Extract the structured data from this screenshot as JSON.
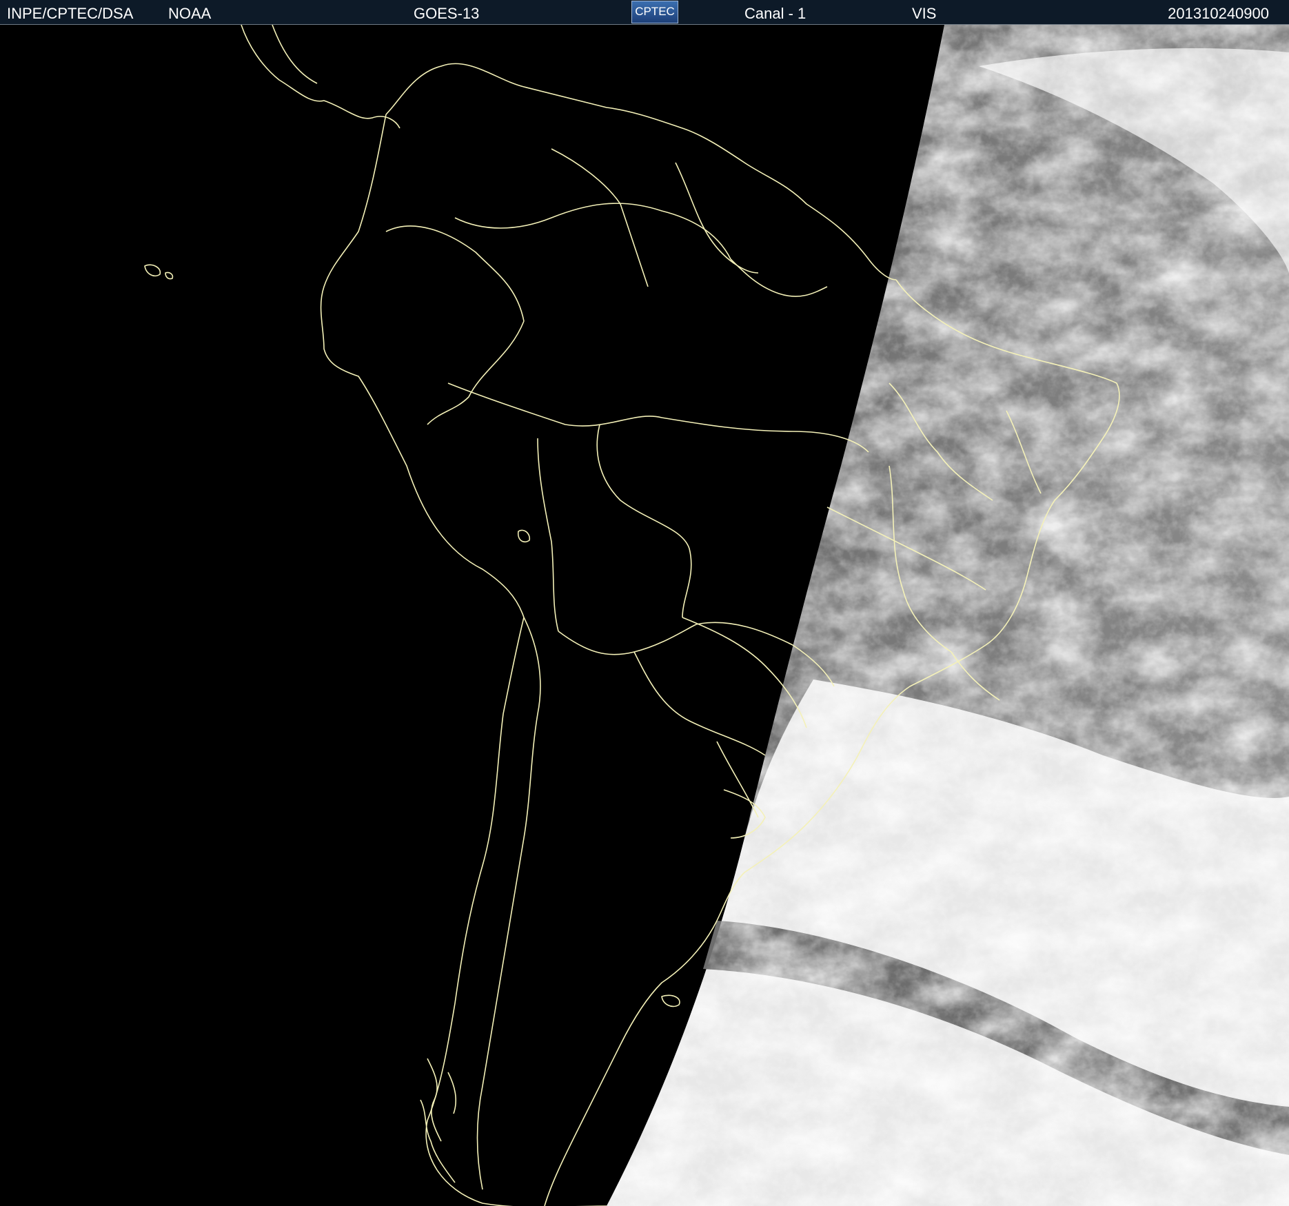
{
  "header": {
    "agency": "INPE/CPTEC/DSA",
    "source": "NOAA",
    "satellite": "GOES-13",
    "logo_text": "CPTEC",
    "channel": "Canal - 1",
    "band": "VIS",
    "timestamp": "201310240900"
  },
  "image": {
    "description_icon": "satellite-visible-image",
    "boundary_color": "#f4f1b8",
    "night_color": "#000000",
    "day_cloud_color": "#f0f0f0",
    "day_ocean_color": "#6a6a6a"
  }
}
